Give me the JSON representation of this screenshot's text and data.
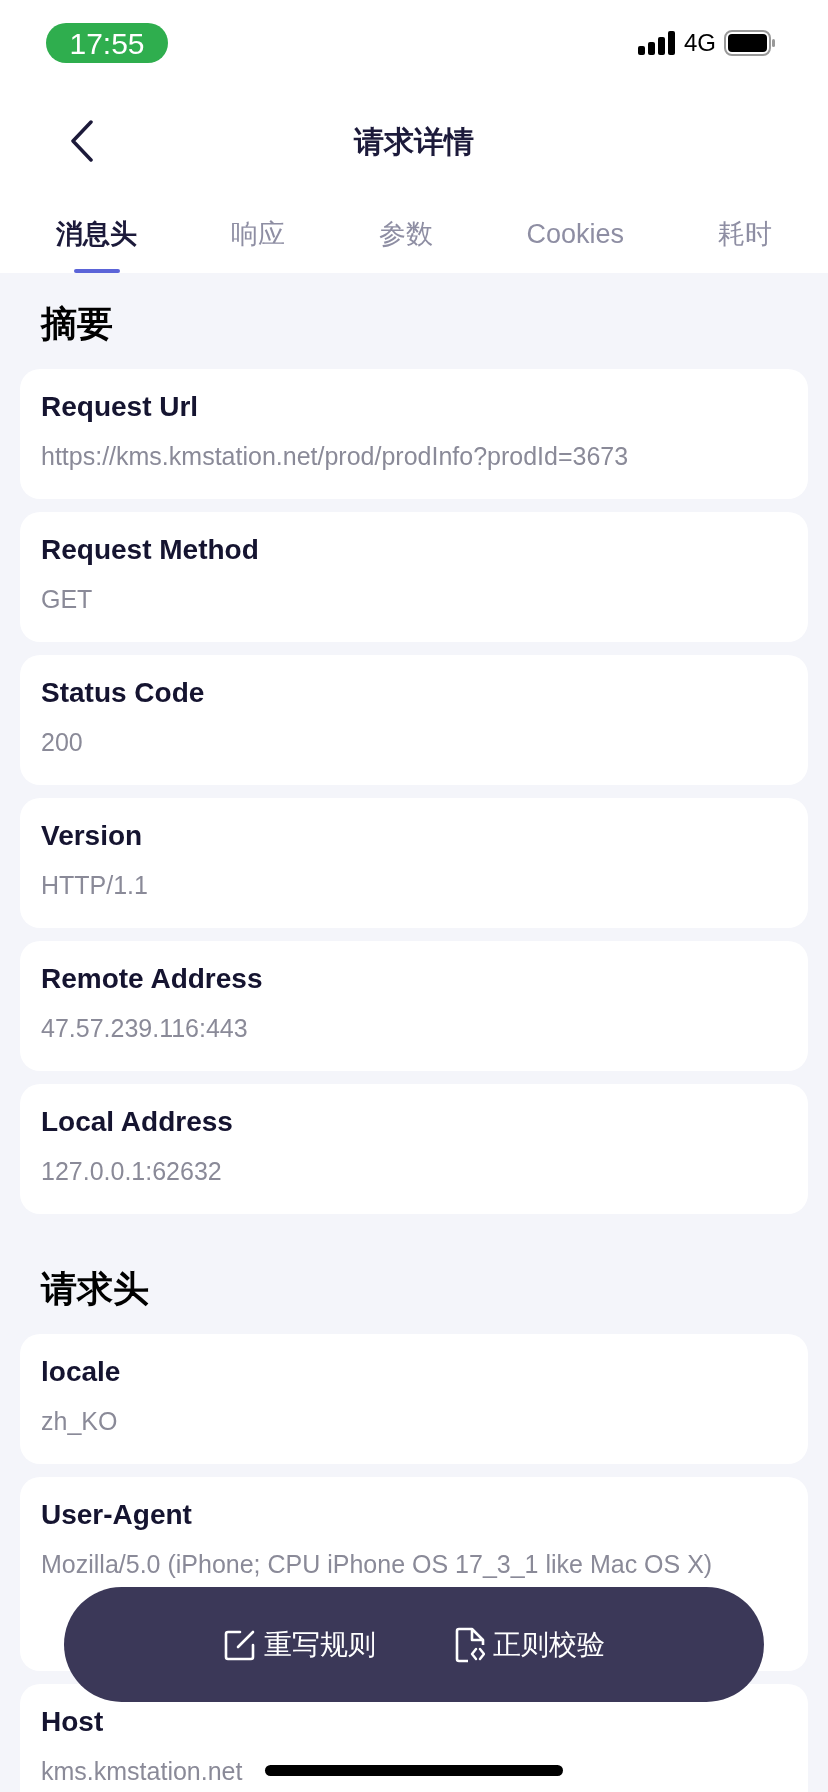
{
  "status_bar": {
    "time": "17:55",
    "network": "4G"
  },
  "nav": {
    "title": "请求详情"
  },
  "tabs": [
    {
      "label": "消息头",
      "selected": true
    },
    {
      "label": "响应",
      "selected": false
    },
    {
      "label": "参数",
      "selected": false
    },
    {
      "label": "Cookies",
      "selected": false
    },
    {
      "label": "耗时",
      "selected": false
    }
  ],
  "sections": [
    {
      "title": "摘要",
      "items": [
        {
          "name": "Request Url",
          "value": "https://kms.kmstation.net/prod/prodInfo?prodId=3673"
        },
        {
          "name": "Request Method",
          "value": "GET"
        },
        {
          "name": "Status Code",
          "value": "200"
        },
        {
          "name": "Version",
          "value": "HTTP/1.1"
        },
        {
          "name": "Remote Address",
          "value": "47.57.239.116:443"
        },
        {
          "name": "Local Address",
          "value": "127.0.0.1:62632"
        }
      ]
    },
    {
      "title": "请求头",
      "items": [
        {
          "name": "locale",
          "value": "zh_KO"
        },
        {
          "name": "User-Agent",
          "value": "Mozilla/5.0 (iPhone; CPU iPhone OS 17_3_1 like Mac OS X)"
        },
        {
          "name": "Host",
          "value": "kms.kmstation.net"
        }
      ]
    }
  ],
  "actions": [
    {
      "kind": "edit",
      "label": "重写规则"
    },
    {
      "kind": "code",
      "label": "正则校验"
    }
  ]
}
